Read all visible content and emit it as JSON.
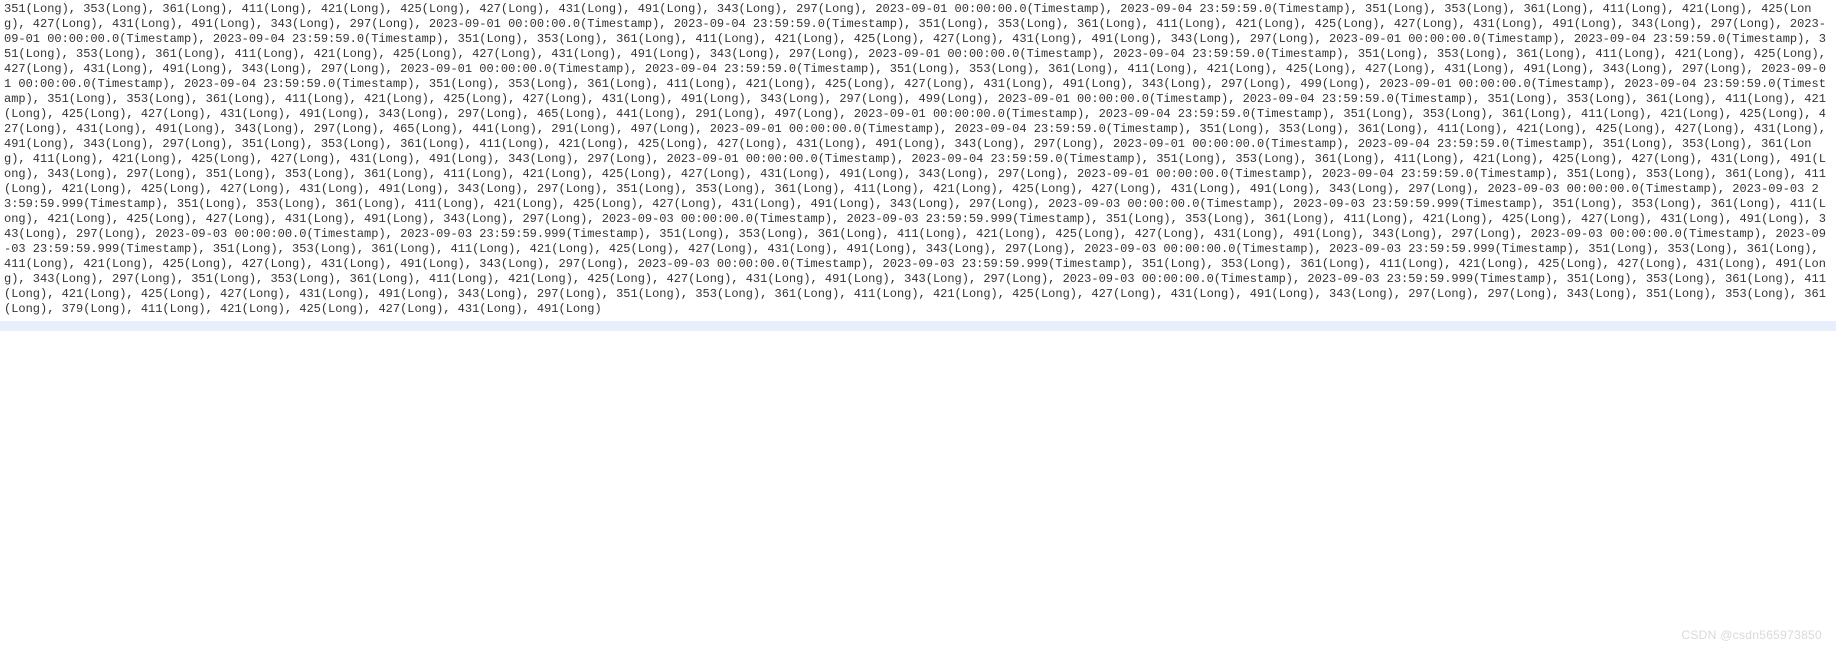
{
  "watermark": "CSDN @csdn565973850",
  "tokens": [
    {
      "t": "L",
      "v": 351
    },
    {
      "t": "L",
      "v": 353
    },
    {
      "t": "L",
      "v": 361
    },
    {
      "t": "L",
      "v": 411
    },
    {
      "t": "L",
      "v": 421
    },
    {
      "t": "L",
      "v": 425
    },
    {
      "t": "L",
      "v": 427
    },
    {
      "t": "L",
      "v": 431
    },
    {
      "t": "L",
      "v": 491
    },
    {
      "t": "L",
      "v": 343
    },
    {
      "t": "L",
      "v": 297
    },
    {
      "t": "T",
      "v": "2023-09-01 00:00:00.0"
    },
    {
      "t": "T",
      "v": "2023-09-04 23:59:59.0"
    },
    {
      "t": "L",
      "v": 351
    },
    {
      "t": "L",
      "v": 353
    },
    {
      "t": "L",
      "v": 361
    },
    {
      "t": "L",
      "v": 411
    },
    {
      "t": "L",
      "v": 421
    },
    {
      "t": "L",
      "v": 425
    },
    {
      "t": "L",
      "v": 427
    },
    {
      "t": "L",
      "v": 431
    },
    {
      "t": "L",
      "v": 491
    },
    {
      "t": "L",
      "v": 343
    },
    {
      "t": "L",
      "v": 297
    },
    {
      "t": "T",
      "v": "2023-09-01 00:00:00.0"
    },
    {
      "t": "T",
      "v": "2023-09-04 23:59:59.0"
    },
    {
      "t": "L",
      "v": 351
    },
    {
      "t": "L",
      "v": 353
    },
    {
      "t": "L",
      "v": 361
    },
    {
      "t": "L",
      "v": 411
    },
    {
      "t": "L",
      "v": 421
    },
    {
      "t": "L",
      "v": 425
    },
    {
      "t": "L",
      "v": 427
    },
    {
      "t": "L",
      "v": 431
    },
    {
      "t": "L",
      "v": 491
    },
    {
      "t": "L",
      "v": 343
    },
    {
      "t": "L",
      "v": 297
    },
    {
      "t": "T",
      "v": "2023-09-01 00:00:00.0"
    },
    {
      "t": "T",
      "v": "2023-09-04 23:59:59.0"
    },
    {
      "t": "L",
      "v": 351
    },
    {
      "t": "L",
      "v": 353
    },
    {
      "t": "L",
      "v": 361
    },
    {
      "t": "L",
      "v": 411
    },
    {
      "t": "L",
      "v": 421
    },
    {
      "t": "L",
      "v": 425
    },
    {
      "t": "L",
      "v": 427
    },
    {
      "t": "L",
      "v": 431
    },
    {
      "t": "L",
      "v": 491
    },
    {
      "t": "L",
      "v": 343
    },
    {
      "t": "L",
      "v": 297
    },
    {
      "t": "T",
      "v": "2023-09-01 00:00:00.0"
    },
    {
      "t": "T",
      "v": "2023-09-04 23:59:59.0"
    },
    {
      "t": "L",
      "v": 351
    },
    {
      "t": "L",
      "v": 353
    },
    {
      "t": "L",
      "v": 361
    },
    {
      "t": "L",
      "v": 411
    },
    {
      "t": "L",
      "v": 421
    },
    {
      "t": "L",
      "v": 425
    },
    {
      "t": "L",
      "v": 427
    },
    {
      "t": "L",
      "v": 431
    },
    {
      "t": "L",
      "v": 491
    },
    {
      "t": "L",
      "v": 343
    },
    {
      "t": "L",
      "v": 297
    },
    {
      "t": "T",
      "v": "2023-09-01 00:00:00.0"
    },
    {
      "t": "T",
      "v": "2023-09-04 23:59:59.0"
    },
    {
      "t": "L",
      "v": 351
    },
    {
      "t": "L",
      "v": 353
    },
    {
      "t": "L",
      "v": 361
    },
    {
      "t": "L",
      "v": 411
    },
    {
      "t": "L",
      "v": 421
    },
    {
      "t": "L",
      "v": 425
    },
    {
      "t": "L",
      "v": 427
    },
    {
      "t": "L",
      "v": 431
    },
    {
      "t": "L",
      "v": 491
    },
    {
      "t": "L",
      "v": 343
    },
    {
      "t": "L",
      "v": 297
    },
    {
      "t": "T",
      "v": "2023-09-01 00:00:00.0"
    },
    {
      "t": "T",
      "v": "2023-09-04 23:59:59.0"
    },
    {
      "t": "L",
      "v": 351
    },
    {
      "t": "L",
      "v": 353
    },
    {
      "t": "L",
      "v": 361
    },
    {
      "t": "L",
      "v": 411
    },
    {
      "t": "L",
      "v": 421
    },
    {
      "t": "L",
      "v": 425
    },
    {
      "t": "L",
      "v": 427
    },
    {
      "t": "L",
      "v": 431
    },
    {
      "t": "L",
      "v": 491
    },
    {
      "t": "L",
      "v": 343
    },
    {
      "t": "L",
      "v": 297
    },
    {
      "t": "T",
      "v": "2023-09-01 00:00:00.0"
    },
    {
      "t": "T",
      "v": "2023-09-04 23:59:59.0"
    },
    {
      "t": "L",
      "v": 351
    },
    {
      "t": "L",
      "v": 353
    },
    {
      "t": "L",
      "v": 361
    },
    {
      "t": "L",
      "v": 411
    },
    {
      "t": "L",
      "v": 421
    },
    {
      "t": "L",
      "v": 425
    },
    {
      "t": "L",
      "v": 427
    },
    {
      "t": "L",
      "v": 431
    },
    {
      "t": "L",
      "v": 491
    },
    {
      "t": "L",
      "v": 343
    },
    {
      "t": "L",
      "v": 297
    },
    {
      "t": "L",
      "v": 499
    },
    {
      "t": "T",
      "v": "2023-09-01 00:00:00.0"
    },
    {
      "t": "T",
      "v": "2023-09-04 23:59:59.0"
    },
    {
      "t": "L",
      "v": 351
    },
    {
      "t": "L",
      "v": 353
    },
    {
      "t": "L",
      "v": 361
    },
    {
      "t": "L",
      "v": 411
    },
    {
      "t": "L",
      "v": 421
    },
    {
      "t": "L",
      "v": 425
    },
    {
      "t": "L",
      "v": 427
    },
    {
      "t": "L",
      "v": 431
    },
    {
      "t": "L",
      "v": 491
    },
    {
      "t": "L",
      "v": 343
    },
    {
      "t": "L",
      "v": 297
    },
    {
      "t": "L",
      "v": 499
    },
    {
      "t": "T",
      "v": "2023-09-01 00:00:00.0"
    },
    {
      "t": "T",
      "v": "2023-09-04 23:59:59.0"
    },
    {
      "t": "L",
      "v": 351
    },
    {
      "t": "L",
      "v": 353
    },
    {
      "t": "L",
      "v": 361
    },
    {
      "t": "L",
      "v": 411
    },
    {
      "t": "L",
      "v": 421
    },
    {
      "t": "L",
      "v": 425
    },
    {
      "t": "L",
      "v": 427
    },
    {
      "t": "L",
      "v": 431
    },
    {
      "t": "L",
      "v": 491
    },
    {
      "t": "L",
      "v": 343
    },
    {
      "t": "L",
      "v": 297
    },
    {
      "t": "L",
      "v": 465
    },
    {
      "t": "L",
      "v": 441
    },
    {
      "t": "L",
      "v": 291
    },
    {
      "t": "L",
      "v": 497
    },
    {
      "t": "T",
      "v": "2023-09-01 00:00:00.0"
    },
    {
      "t": "T",
      "v": "2023-09-04 23:59:59.0"
    },
    {
      "t": "L",
      "v": 351
    },
    {
      "t": "L",
      "v": 353
    },
    {
      "t": "L",
      "v": 361
    },
    {
      "t": "L",
      "v": 411
    },
    {
      "t": "L",
      "v": 421
    },
    {
      "t": "L",
      "v": 425
    },
    {
      "t": "L",
      "v": 427
    },
    {
      "t": "L",
      "v": 431
    },
    {
      "t": "L",
      "v": 491
    },
    {
      "t": "L",
      "v": 343
    },
    {
      "t": "L",
      "v": 297
    },
    {
      "t": "L",
      "v": 465
    },
    {
      "t": "L",
      "v": 441
    },
    {
      "t": "L",
      "v": 291
    },
    {
      "t": "L",
      "v": 497
    },
    {
      "t": "T",
      "v": "2023-09-01 00:00:00.0"
    },
    {
      "t": "T",
      "v": "2023-09-04 23:59:59.0"
    },
    {
      "t": "L",
      "v": 351
    },
    {
      "t": "L",
      "v": 353
    },
    {
      "t": "L",
      "v": 361
    },
    {
      "t": "L",
      "v": 411
    },
    {
      "t": "L",
      "v": 421
    },
    {
      "t": "L",
      "v": 425
    },
    {
      "t": "L",
      "v": 427
    },
    {
      "t": "L",
      "v": 431
    },
    {
      "t": "L",
      "v": 491
    },
    {
      "t": "L",
      "v": 343
    },
    {
      "t": "L",
      "v": 297
    },
    {
      "t": "L",
      "v": 351
    },
    {
      "t": "L",
      "v": 353
    },
    {
      "t": "L",
      "v": 361
    },
    {
      "t": "L",
      "v": 411
    },
    {
      "t": "L",
      "v": 421
    },
    {
      "t": "L",
      "v": 425
    },
    {
      "t": "L",
      "v": 427
    },
    {
      "t": "L",
      "v": 431
    },
    {
      "t": "L",
      "v": 491
    },
    {
      "t": "L",
      "v": 343
    },
    {
      "t": "L",
      "v": 297
    },
    {
      "t": "T",
      "v": "2023-09-01 00:00:00.0"
    },
    {
      "t": "T",
      "v": "2023-09-04 23:59:59.0"
    },
    {
      "t": "L",
      "v": 351
    },
    {
      "t": "L",
      "v": 353
    },
    {
      "t": "L",
      "v": 361
    },
    {
      "t": "L",
      "v": 411
    },
    {
      "t": "L",
      "v": 421
    },
    {
      "t": "L",
      "v": 425
    },
    {
      "t": "L",
      "v": 427
    },
    {
      "t": "L",
      "v": 431
    },
    {
      "t": "L",
      "v": 491
    },
    {
      "t": "L",
      "v": 343
    },
    {
      "t": "L",
      "v": 297
    },
    {
      "t": "T",
      "v": "2023-09-01 00:00:00.0"
    },
    {
      "t": "T",
      "v": "2023-09-04 23:59:59.0"
    },
    {
      "t": "L",
      "v": 351
    },
    {
      "t": "L",
      "v": 353
    },
    {
      "t": "L",
      "v": 361
    },
    {
      "t": "L",
      "v": 411
    },
    {
      "t": "L",
      "v": 421
    },
    {
      "t": "L",
      "v": 425
    },
    {
      "t": "L",
      "v": 427
    },
    {
      "t": "L",
      "v": 431
    },
    {
      "t": "L",
      "v": 491
    },
    {
      "t": "L",
      "v": 343
    },
    {
      "t": "L",
      "v": 297
    },
    {
      "t": "L",
      "v": 351
    },
    {
      "t": "L",
      "v": 353
    },
    {
      "t": "L",
      "v": 361
    },
    {
      "t": "L",
      "v": 411
    },
    {
      "t": "L",
      "v": 421
    },
    {
      "t": "L",
      "v": 425
    },
    {
      "t": "L",
      "v": 427
    },
    {
      "t": "L",
      "v": 431
    },
    {
      "t": "L",
      "v": 491
    },
    {
      "t": "L",
      "v": 343
    },
    {
      "t": "L",
      "v": 297
    },
    {
      "t": "T",
      "v": "2023-09-01 00:00:00.0"
    },
    {
      "t": "T",
      "v": "2023-09-04 23:59:59.0"
    },
    {
      "t": "L",
      "v": 351
    },
    {
      "t": "L",
      "v": 353
    },
    {
      "t": "L",
      "v": 361
    },
    {
      "t": "L",
      "v": 411
    },
    {
      "t": "L",
      "v": 421
    },
    {
      "t": "L",
      "v": 425
    },
    {
      "t": "L",
      "v": 427
    },
    {
      "t": "L",
      "v": 431
    },
    {
      "t": "L",
      "v": 491
    },
    {
      "t": "L",
      "v": 343
    },
    {
      "t": "L",
      "v": 297
    },
    {
      "t": "L",
      "v": 351
    },
    {
      "t": "L",
      "v": 353
    },
    {
      "t": "L",
      "v": 361
    },
    {
      "t": "L",
      "v": 411
    },
    {
      "t": "L",
      "v": 421
    },
    {
      "t": "L",
      "v": 425
    },
    {
      "t": "L",
      "v": 427
    },
    {
      "t": "L",
      "v": 431
    },
    {
      "t": "L",
      "v": 491
    },
    {
      "t": "L",
      "v": 343
    },
    {
      "t": "L",
      "v": 297
    },
    {
      "t": "T",
      "v": "2023-09-03 00:00:00.0"
    },
    {
      "t": "T",
      "v": "2023-09-03 23:59:59.999"
    },
    {
      "t": "L",
      "v": 351
    },
    {
      "t": "L",
      "v": 353
    },
    {
      "t": "L",
      "v": 361
    },
    {
      "t": "L",
      "v": 411
    },
    {
      "t": "L",
      "v": 421
    },
    {
      "t": "L",
      "v": 425
    },
    {
      "t": "L",
      "v": 427
    },
    {
      "t": "L",
      "v": 431
    },
    {
      "t": "L",
      "v": 491
    },
    {
      "t": "L",
      "v": 343
    },
    {
      "t": "L",
      "v": 297
    },
    {
      "t": "T",
      "v": "2023-09-03 00:00:00.0"
    },
    {
      "t": "T",
      "v": "2023-09-03 23:59:59.999"
    },
    {
      "t": "L",
      "v": 351
    },
    {
      "t": "L",
      "v": 353
    },
    {
      "t": "L",
      "v": 361
    },
    {
      "t": "L",
      "v": 411
    },
    {
      "t": "L",
      "v": 421
    },
    {
      "t": "L",
      "v": 425
    },
    {
      "t": "L",
      "v": 427
    },
    {
      "t": "L",
      "v": 431
    },
    {
      "t": "L",
      "v": 491
    },
    {
      "t": "L",
      "v": 343
    },
    {
      "t": "L",
      "v": 297
    },
    {
      "t": "T",
      "v": "2023-09-03 00:00:00.0"
    },
    {
      "t": "T",
      "v": "2023-09-03 23:59:59.999"
    },
    {
      "t": "L",
      "v": 351
    },
    {
      "t": "L",
      "v": 353
    },
    {
      "t": "L",
      "v": 361
    },
    {
      "t": "L",
      "v": 411
    },
    {
      "t": "L",
      "v": 421
    },
    {
      "t": "L",
      "v": 425
    },
    {
      "t": "L",
      "v": 427
    },
    {
      "t": "L",
      "v": 431
    },
    {
      "t": "L",
      "v": 491
    },
    {
      "t": "L",
      "v": 343
    },
    {
      "t": "L",
      "v": 297
    },
    {
      "t": "T",
      "v": "2023-09-03 00:00:00.0"
    },
    {
      "t": "T",
      "v": "2023-09-03 23:59:59.999"
    },
    {
      "t": "L",
      "v": 351
    },
    {
      "t": "L",
      "v": 353
    },
    {
      "t": "L",
      "v": 361
    },
    {
      "t": "L",
      "v": 411
    },
    {
      "t": "L",
      "v": 421
    },
    {
      "t": "L",
      "v": 425
    },
    {
      "t": "L",
      "v": 427
    },
    {
      "t": "L",
      "v": 431
    },
    {
      "t": "L",
      "v": 491
    },
    {
      "t": "L",
      "v": 343
    },
    {
      "t": "L",
      "v": 297
    },
    {
      "t": "T",
      "v": "2023-09-03 00:00:00.0"
    },
    {
      "t": "T",
      "v": "2023-09-03 23:59:59.999"
    },
    {
      "t": "L",
      "v": 351
    },
    {
      "t": "L",
      "v": 353
    },
    {
      "t": "L",
      "v": 361
    },
    {
      "t": "L",
      "v": 411
    },
    {
      "t": "L",
      "v": 421
    },
    {
      "t": "L",
      "v": 425
    },
    {
      "t": "L",
      "v": 427
    },
    {
      "t": "L",
      "v": 431
    },
    {
      "t": "L",
      "v": 491
    },
    {
      "t": "L",
      "v": 343
    },
    {
      "t": "L",
      "v": 297
    },
    {
      "t": "T",
      "v": "2023-09-03 00:00:00.0"
    },
    {
      "t": "T",
      "v": "2023-09-03 23:59:59.999"
    },
    {
      "t": "L",
      "v": 351
    },
    {
      "t": "L",
      "v": 353
    },
    {
      "t": "L",
      "v": 361
    },
    {
      "t": "L",
      "v": 411
    },
    {
      "t": "L",
      "v": 421
    },
    {
      "t": "L",
      "v": 425
    },
    {
      "t": "L",
      "v": 427
    },
    {
      "t": "L",
      "v": 431
    },
    {
      "t": "L",
      "v": 491
    },
    {
      "t": "L",
      "v": 343
    },
    {
      "t": "L",
      "v": 297
    },
    {
      "t": "T",
      "v": "2023-09-03 00:00:00.0"
    },
    {
      "t": "T",
      "v": "2023-09-03 23:59:59.999"
    },
    {
      "t": "L",
      "v": 351
    },
    {
      "t": "L",
      "v": 353
    },
    {
      "t": "L",
      "v": 361
    },
    {
      "t": "L",
      "v": 411
    },
    {
      "t": "L",
      "v": 421
    },
    {
      "t": "L",
      "v": 425
    },
    {
      "t": "L",
      "v": 427
    },
    {
      "t": "L",
      "v": 431
    },
    {
      "t": "L",
      "v": 491
    },
    {
      "t": "L",
      "v": 343
    },
    {
      "t": "L",
      "v": 297
    },
    {
      "t": "L",
      "v": 351
    },
    {
      "t": "L",
      "v": 353
    },
    {
      "t": "L",
      "v": 361
    },
    {
      "t": "L",
      "v": 411
    },
    {
      "t": "L",
      "v": 421
    },
    {
      "t": "L",
      "v": 425
    },
    {
      "t": "L",
      "v": 427
    },
    {
      "t": "L",
      "v": 431
    },
    {
      "t": "L",
      "v": 491
    },
    {
      "t": "L",
      "v": 343
    },
    {
      "t": "L",
      "v": 297
    },
    {
      "t": "T",
      "v": "2023-09-03 00:00:00.0"
    },
    {
      "t": "T",
      "v": "2023-09-03 23:59:59.999"
    },
    {
      "t": "L",
      "v": 351
    },
    {
      "t": "L",
      "v": 353
    },
    {
      "t": "L",
      "v": 361
    },
    {
      "t": "L",
      "v": 411
    },
    {
      "t": "L",
      "v": 421
    },
    {
      "t": "L",
      "v": 425
    },
    {
      "t": "L",
      "v": 427
    },
    {
      "t": "L",
      "v": 431
    },
    {
      "t": "L",
      "v": 491
    },
    {
      "t": "L",
      "v": 343
    },
    {
      "t": "L",
      "v": 297
    },
    {
      "t": "L",
      "v": 351
    },
    {
      "t": "L",
      "v": 353
    },
    {
      "t": "L",
      "v": 361
    },
    {
      "t": "L",
      "v": 411
    },
    {
      "t": "L",
      "v": 421
    },
    {
      "t": "L",
      "v": 425
    },
    {
      "t": "L",
      "v": 427
    },
    {
      "t": "L",
      "v": 431
    },
    {
      "t": "L",
      "v": 491
    },
    {
      "t": "L",
      "v": 343
    },
    {
      "t": "L",
      "v": 297
    },
    {
      "t": "L",
      "v": 297
    },
    {
      "t": "L",
      "v": 343
    },
    {
      "t": "L",
      "v": 351
    },
    {
      "t": "L",
      "v": 353
    },
    {
      "t": "L",
      "v": 361
    },
    {
      "t": "L",
      "v": 379
    },
    {
      "t": "L",
      "v": 411
    },
    {
      "t": "L",
      "v": 421
    },
    {
      "t": "L",
      "v": 425
    },
    {
      "t": "L",
      "v": 427
    },
    {
      "t": "L",
      "v": 431
    },
    {
      "t": "L",
      "v": 491
    }
  ]
}
